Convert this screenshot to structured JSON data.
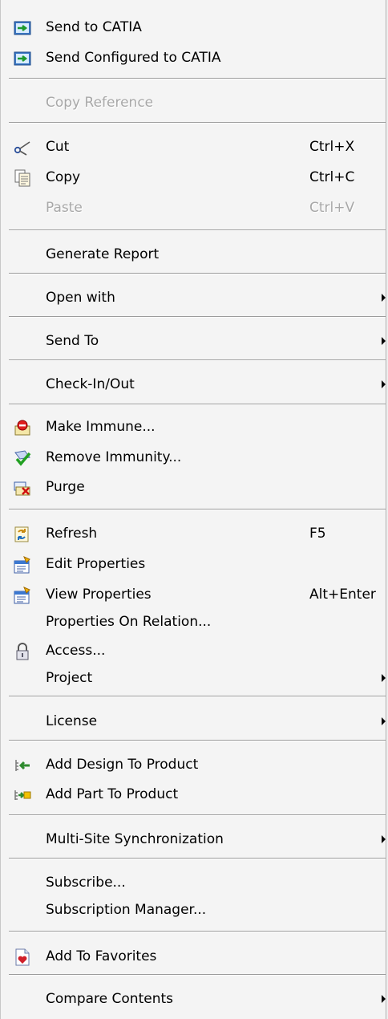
{
  "menu": {
    "send_to_catia": "Send to CATIA",
    "send_configured_to_catia": "Send Configured to CATIA",
    "copy_reference": "Copy Reference",
    "cut": "Cut",
    "cut_shortcut": "Ctrl+X",
    "copy": "Copy",
    "copy_shortcut": "Ctrl+C",
    "paste": "Paste",
    "paste_shortcut": "Ctrl+V",
    "generate_report": "Generate Report",
    "open_with": "Open with",
    "send_to": "Send To",
    "check_in_out": "Check-In/Out",
    "make_immune": "Make Immune...",
    "remove_immunity": "Remove Immunity...",
    "purge": "Purge",
    "refresh": "Refresh",
    "refresh_shortcut": "F5",
    "edit_properties": "Edit Properties",
    "view_properties": "View Properties",
    "view_properties_shortcut": "Alt+Enter",
    "properties_on_relation": "Properties On Relation...",
    "access": "Access...",
    "project": "Project",
    "license": "License",
    "add_design_to_product": "Add Design To Product",
    "add_part_to_product": "Add Part To Product",
    "multi_site_sync": "Multi-Site Synchronization",
    "subscribe": "Subscribe...",
    "subscription_manager": "Subscription Manager...",
    "add_to_favorites": "Add To Favorites",
    "compare_contents": "Compare Contents"
  }
}
